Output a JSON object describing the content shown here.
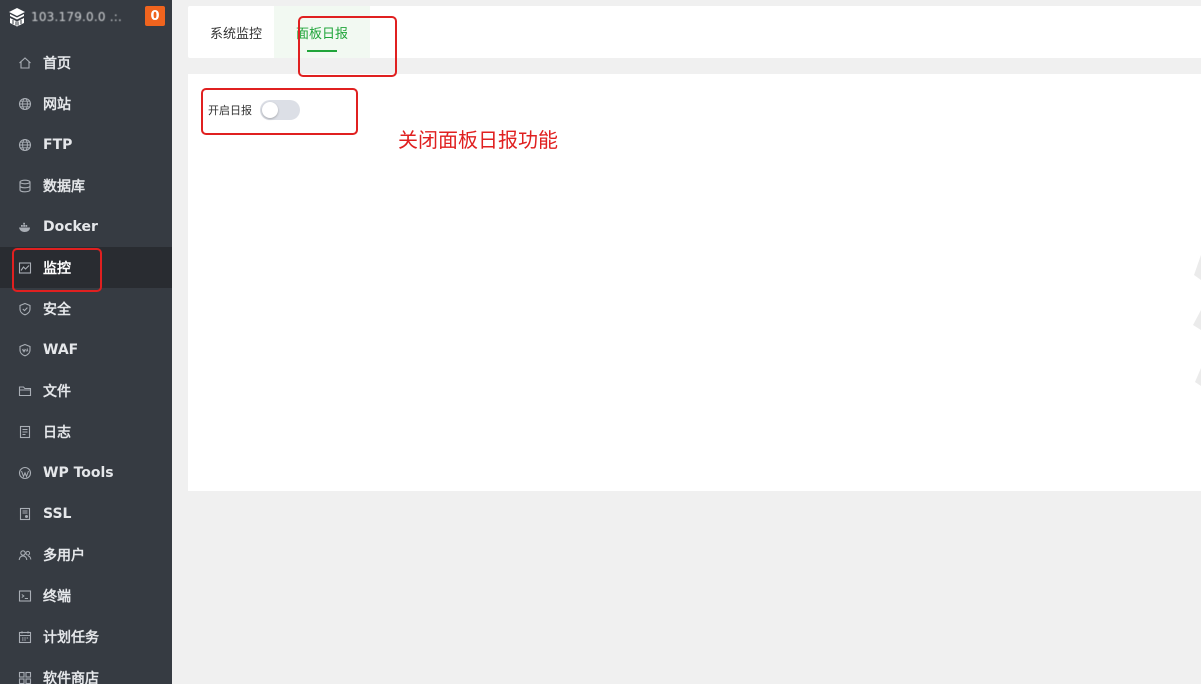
{
  "sidebar": {
    "host": "103.179.0.0 .:.",
    "badge": "0",
    "items": [
      {
        "label": "首页",
        "icon": "home-icon"
      },
      {
        "label": "网站",
        "icon": "globe-icon"
      },
      {
        "label": "FTP",
        "icon": "globe-icon"
      },
      {
        "label": "数据库",
        "icon": "database-icon"
      },
      {
        "label": "Docker",
        "icon": "docker-icon"
      },
      {
        "label": "监控",
        "icon": "monitor-icon",
        "active": true
      },
      {
        "label": "安全",
        "icon": "shield-icon"
      },
      {
        "label": "WAF",
        "icon": "waf-shield-icon"
      },
      {
        "label": "文件",
        "icon": "folder-icon"
      },
      {
        "label": "日志",
        "icon": "log-icon"
      },
      {
        "label": "WP Tools",
        "icon": "wordpress-icon"
      },
      {
        "label": "SSL",
        "icon": "certificate-icon"
      },
      {
        "label": "多用户",
        "icon": "users-icon"
      },
      {
        "label": "终端",
        "icon": "terminal-icon"
      },
      {
        "label": "计划任务",
        "icon": "calendar-icon"
      },
      {
        "label": "软件商店",
        "icon": "apps-icon"
      }
    ]
  },
  "tabs": [
    {
      "label": "系统监控"
    },
    {
      "label": "面板日报",
      "active": true
    }
  ],
  "report": {
    "switch_label": "开启日报",
    "enabled": false
  },
  "annotation": {
    "note": "关闭面板日报功能",
    "color": "#e02020"
  },
  "colors": {
    "sidebar_bg": "#363b42",
    "accent": "#20a53a",
    "badge": "#f0641e"
  }
}
